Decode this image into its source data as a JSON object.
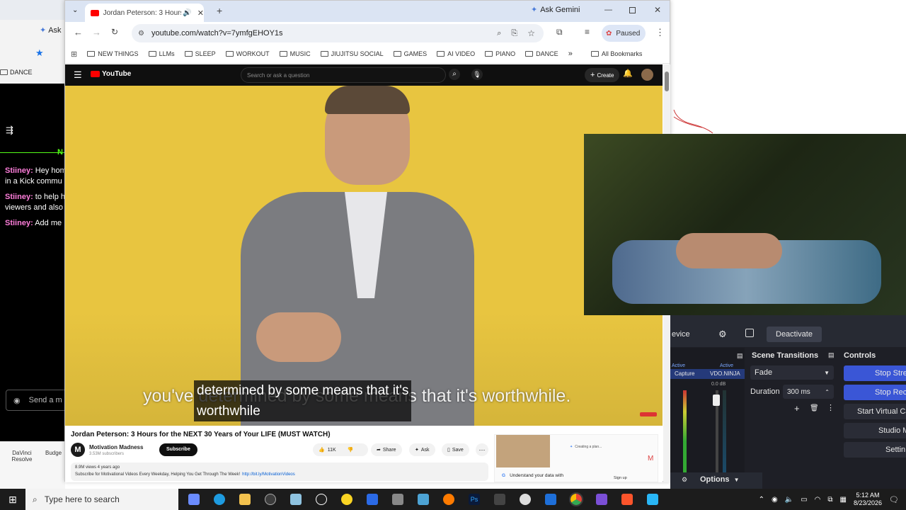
{
  "bg_left": {
    "tab_label": "Ask",
    "bookmark_label": "DANCE",
    "chat_header": "N",
    "chat": [
      {
        "user": "Stiiney:",
        "text": "Hey hom"
      },
      {
        "user": "",
        "text": "in a Kick commu"
      },
      {
        "user": "Stiiney:",
        "text": "to help h"
      },
      {
        "user": "",
        "text": "viewers and also"
      },
      {
        "user": "Stiiney:",
        "text": "Add me"
      }
    ],
    "send_placeholder": "Send a m",
    "desktop_icons": [
      "DaVinci Resolve",
      "Budge"
    ]
  },
  "chrome": {
    "tab_title": "Jordan Peterson: 3 Hours fo",
    "gemini_label": "Ask Gemini",
    "url": "youtube.com/watch?v=7ymfgEHOY1s",
    "paused_label": "Paused",
    "bookmarks": [
      "NEW THINGS",
      "LLMs",
      "SLEEP",
      "WORKOUT",
      "MUSIC",
      "JIUJITSU SOCIAL",
      "GAMES",
      "AI VIDEO",
      "PIANO",
      "DANCE"
    ],
    "all_bookmarks": "All Bookmarks"
  },
  "youtube": {
    "logo_text": "YouTube",
    "search_placeholder": "Search or ask a question",
    "create_label": "Create",
    "caption_line1": "determined by some means that it's",
    "caption_line2": "worthwhile",
    "caption_ghost": "you've determined by some means that it's worthwhile.",
    "video_title": "Jordan Peterson: 3 Hours for the NEXT 30 Years of Your LIFE (MUST WATCH)",
    "channel_name": "Motivation Madness",
    "subscribers": "3.53M subscribers",
    "subscribe_label": "Subscribe",
    "likes": "11K",
    "share_label": "Share",
    "ask_label": "Ask",
    "save_label": "Save",
    "views_line": "8.9M views  4 years ago",
    "description": "Subscribe for Motivational Videos Every Weekday, Helping You Get Through The Week!",
    "description_link": "http://bit.ly/MotivationVideos",
    "ad_text": "Understand your data with",
    "ad_creating": "Creating a plan...",
    "ad_signup": "Sign up"
  },
  "obs": {
    "device_label": "evice",
    "deactivate_label": "Deactivate",
    "scene_transitions_title": "Scene Transitions",
    "controls_title": "Controls",
    "mixer_active_1": "Active",
    "mixer_active_2": "Active",
    "mixer_source_1": "Capture",
    "mixer_source_2": "VDO.NINJA",
    "mixer_db": "0.0 dB",
    "transition": "Fade",
    "duration_label": "Duration",
    "duration_value": "300 ms",
    "options_label": "Options",
    "controls": [
      "Stop Stre",
      "Stop Reco",
      "Start Virtual Ca",
      "Studio M",
      "Settin"
    ]
  },
  "taskbar": {
    "search_placeholder": "Type here to search",
    "time": "5:12 AM",
    "date": "8/23/2026"
  }
}
